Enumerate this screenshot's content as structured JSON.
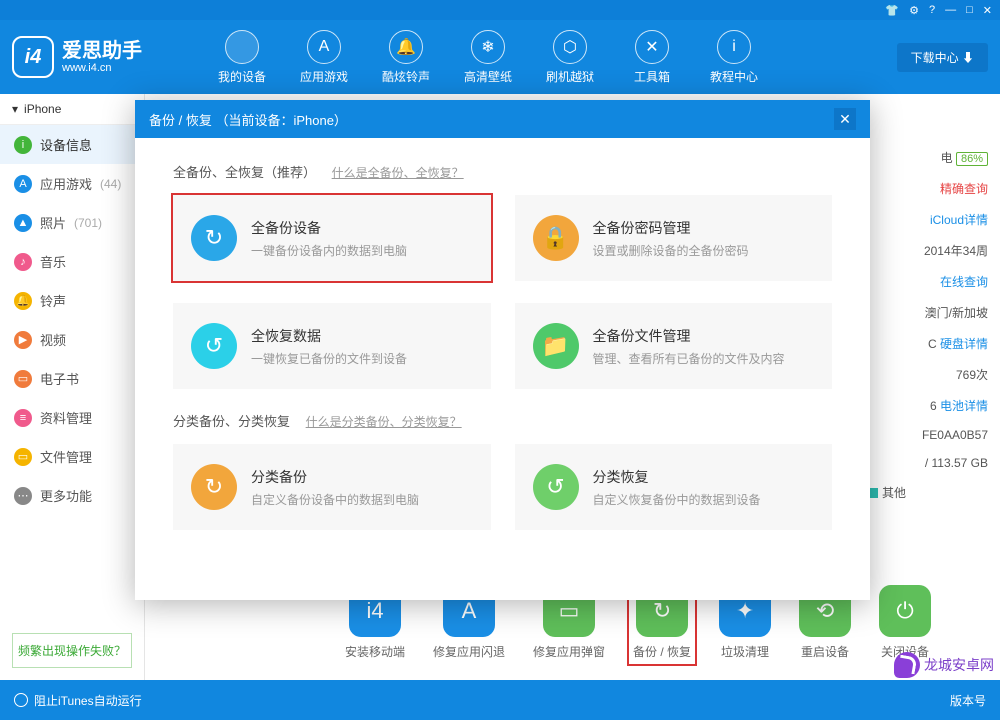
{
  "titlebar": {
    "icons": [
      "👕",
      "⚙",
      "?",
      "—",
      "□",
      "✕"
    ]
  },
  "header": {
    "logo_badge": "i4",
    "logo_cn": "爱思助手",
    "logo_en": "www.i4.cn",
    "download_center": "下载中心 ⬇",
    "nav": [
      {
        "label": "我的设备",
        "glyph": ""
      },
      {
        "label": "应用游戏",
        "glyph": "A"
      },
      {
        "label": "酷炫铃声",
        "glyph": "🔔"
      },
      {
        "label": "高清壁纸",
        "glyph": "❄"
      },
      {
        "label": "刷机越狱",
        "glyph": "⬡"
      },
      {
        "label": "工具箱",
        "glyph": "✕"
      },
      {
        "label": "教程中心",
        "glyph": "i"
      }
    ]
  },
  "sidebar": {
    "device": "iPhone",
    "items": [
      {
        "label": "设备信息",
        "color": "#43b53a",
        "glyph": "i",
        "active": true
      },
      {
        "label": "应用游戏",
        "count": "(44)",
        "color": "#1a8fe6",
        "glyph": "A"
      },
      {
        "label": "照片",
        "count": "(701)",
        "color": "#1a8fe6",
        "glyph": "▲"
      },
      {
        "label": "音乐",
        "color": "#f05a8c",
        "glyph": "♪"
      },
      {
        "label": "铃声",
        "color": "#f5b400",
        "glyph": "🔔"
      },
      {
        "label": "视频",
        "color": "#f07b3c",
        "glyph": "▶"
      },
      {
        "label": "电子书",
        "color": "#f07b3c",
        "glyph": "▭"
      },
      {
        "label": "资料管理",
        "color": "#f05a8c",
        "glyph": "≡"
      },
      {
        "label": "文件管理",
        "color": "#f5b400",
        "glyph": "▭"
      },
      {
        "label": "更多功能",
        "color": "#888",
        "glyph": "⋯"
      }
    ],
    "footer_link": "频繁出现操作失败？"
  },
  "right": {
    "battery_label": "电",
    "battery_pct": "86%",
    "rows": [
      {
        "text": "精确查询",
        "link": true,
        "color": "#e64545"
      },
      {
        "text": "iCloud详情",
        "link": true
      },
      {
        "text": "2014年34周"
      },
      {
        "text": "在线查询",
        "link": true
      },
      {
        "text": "澳门/新加坡"
      },
      {
        "text": "硬盘详情",
        "link": true,
        "prefix": "C"
      },
      {
        "text": "769次"
      },
      {
        "text": "电池详情",
        "link": true,
        "prefix": "6"
      },
      {
        "text": "FE0AA0B57"
      }
    ],
    "storage": "/ 113.57 GB",
    "legend": "其他"
  },
  "toolbar": [
    {
      "label": "安装移动端",
      "bg": "#1a8fe6",
      "glyph": "i4"
    },
    {
      "label": "修复应用闪退",
      "bg": "#1a8fe6",
      "glyph": "A"
    },
    {
      "label": "修复应用弹窗",
      "bg": "#5fbf5a",
      "glyph": "▭"
    },
    {
      "label": "备份 / 恢复",
      "bg": "#5fbf5a",
      "glyph": "↻",
      "hl": true
    },
    {
      "label": "垃圾清理",
      "bg": "#1a8fe6",
      "glyph": "✦"
    },
    {
      "label": "重启设备",
      "bg": "#5fbf5a",
      "glyph": "⟲"
    },
    {
      "label": "关闭设备",
      "bg": "#5fbf5a",
      "glyph": "⏻"
    }
  ],
  "footer": {
    "left": "阻止iTunes自动运行",
    "right": "版本号"
  },
  "modal": {
    "title": "备份 / 恢复  （当前设备：iPhone）",
    "sec1_title": "全备份、全恢复（推荐）",
    "sec1_help": "什么是全备份、全恢复？",
    "sec2_title": "分类备份、分类恢复",
    "sec2_help": "什么是分类备份、分类恢复？",
    "cards1": [
      {
        "t": "全备份设备",
        "d": "一键备份设备内的数据到电脑",
        "bg": "#2aa7e8",
        "glyph": "↻",
        "hl": true
      },
      {
        "t": "全备份密码管理",
        "d": "设置或删除设备的全备份密码",
        "bg": "#f2a63c",
        "glyph": "🔒"
      }
    ],
    "cards2": [
      {
        "t": "全恢复数据",
        "d": "一键恢复已备份的文件到设备",
        "bg": "#2bd0e8",
        "glyph": "↺"
      },
      {
        "t": "全备份文件管理",
        "d": "管理、查看所有已备份的文件及内容",
        "bg": "#4fc96a",
        "glyph": "📁"
      }
    ],
    "cards3": [
      {
        "t": "分类备份",
        "d": "自定义备份设备中的数据到电脑",
        "bg": "#f2a63c",
        "glyph": "↻"
      },
      {
        "t": "分类恢复",
        "d": "自定义恢复备份中的数据到设备",
        "bg": "#6fcf6a",
        "glyph": "↺"
      }
    ]
  },
  "watermark": "龙城安卓网"
}
